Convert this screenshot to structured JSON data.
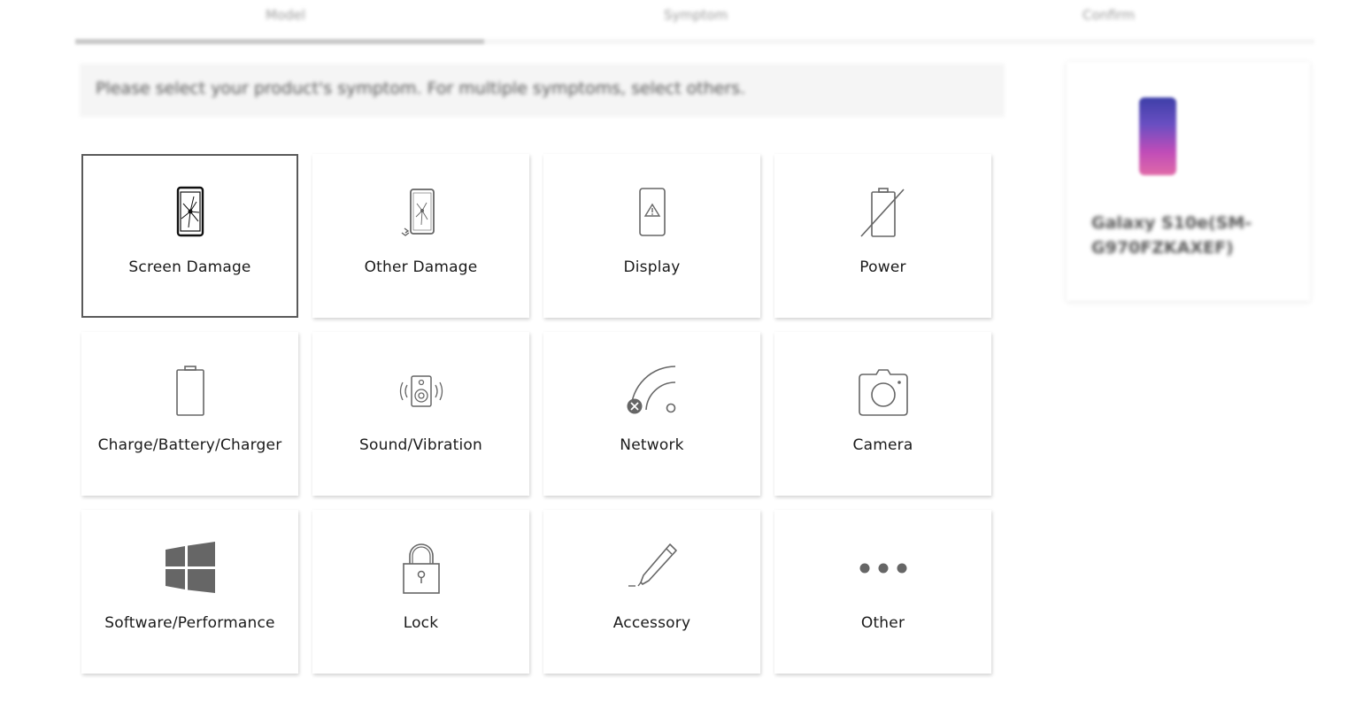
{
  "steps": {
    "items": [
      "Model",
      "Symptom",
      "Confirm"
    ],
    "progress": 0.33
  },
  "notice": "Please select your product's symptom. For multiple symptoms, select others.",
  "symptoms": [
    {
      "label": "Screen Damage",
      "icon": "cracked-screen-icon",
      "selected": true
    },
    {
      "label": "Other Damage",
      "icon": "damaged-phone-icon",
      "selected": false
    },
    {
      "label": "Display",
      "icon": "display-warning-icon",
      "selected": false
    },
    {
      "label": "Power",
      "icon": "power-off-icon",
      "selected": false
    },
    {
      "label": "Charge/Battery/Charger",
      "icon": "battery-icon",
      "selected": false
    },
    {
      "label": "Sound/Vibration",
      "icon": "speaker-icon",
      "selected": false
    },
    {
      "label": "Network",
      "icon": "network-icon",
      "selected": false
    },
    {
      "label": "Camera",
      "icon": "camera-icon",
      "selected": false
    },
    {
      "label": "Software/Performance",
      "icon": "windows-icon",
      "selected": false
    },
    {
      "label": "Lock",
      "icon": "lock-icon",
      "selected": false
    },
    {
      "label": "Accessory",
      "icon": "pen-icon",
      "selected": false
    },
    {
      "label": "Other",
      "icon": "more-icon",
      "selected": false
    }
  ],
  "product": {
    "name": "Galaxy S10e(SM-G970FZKAXEF)",
    "sub": "",
    "image_colors": [
      "#3d3fa8",
      "#e06aa8"
    ]
  },
  "colors": {
    "selected_border": "#5a5a5a",
    "icon_stroke": "#666666",
    "icon_dark": "#111111"
  }
}
